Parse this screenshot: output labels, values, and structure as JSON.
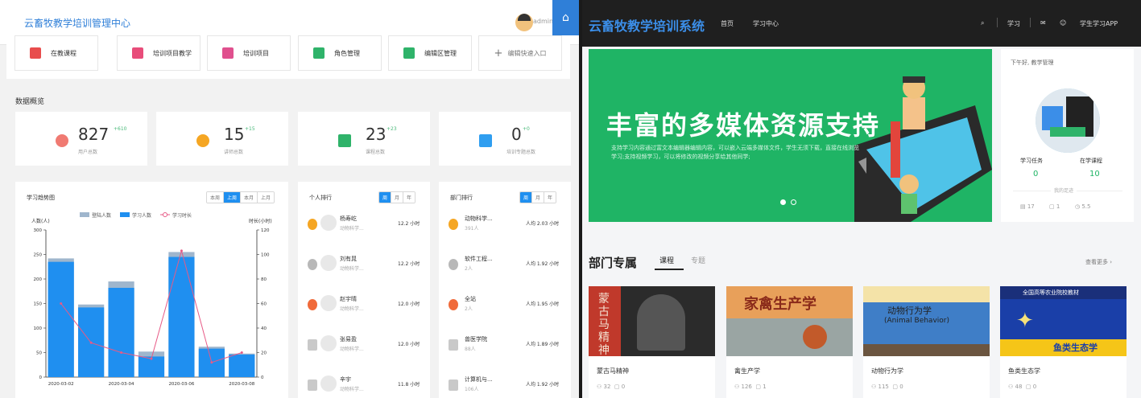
{
  "left": {
    "header": {
      "title": "云畜牧教学培训管理中心",
      "user": "admin",
      "home_icon": "home-icon"
    },
    "shortcuts": [
      {
        "label": "在教课程",
        "icon": "book-icon",
        "color": "#e84d4d"
      },
      {
        "label": "培训项目教学",
        "icon": "picture-icon",
        "color": "#e84d7a"
      },
      {
        "label": "培训项目",
        "icon": "calendar-icon",
        "color": "#e0508e"
      },
      {
        "label": "角色管理",
        "icon": "role-icon",
        "color": "#2fb36a"
      },
      {
        "label": "编辑区管理",
        "icon": "edit-icon",
        "color": "#2fb36a"
      },
      {
        "label": "编辑快速入口",
        "icon": "plus-icon",
        "color": "#777777"
      }
    ],
    "overview": {
      "title": "数据概览",
      "cards": [
        {
          "value": "827",
          "delta": "+610",
          "label": "用户总数",
          "icon": "user-icon",
          "color": "#f07a72"
        },
        {
          "value": "15",
          "delta": "+15",
          "label": "讲师总数",
          "icon": "teacher-icon",
          "color": "#f5a623"
        },
        {
          "value": "23",
          "delta": "+23",
          "label": "课程总数",
          "icon": "course-icon",
          "color": "#2fb36a"
        },
        {
          "value": "0",
          "delta": "+0",
          "label": "培训专题总数",
          "icon": "topic-icon",
          "color": "#2f9ef0"
        }
      ]
    },
    "trend": {
      "title": "学习趋势图",
      "ranges": [
        "本周",
        "上周",
        "本月",
        "上月"
      ],
      "active_range": "上周"
    },
    "person_rank": {
      "title": "个人排行",
      "ranges": [
        "周",
        "月",
        "年"
      ],
      "active_range": "周",
      "rows": [
        {
          "name": "杨寿屹",
          "sub": "动物科学...",
          "value": "12.2 小时",
          "medal": "gold"
        },
        {
          "name": "刘有晁",
          "sub": "动物科学...",
          "value": "12.2 小时",
          "medal": "silver"
        },
        {
          "name": "赵宇晴",
          "sub": "动物科学...",
          "value": "12.0 小时",
          "medal": "bronze"
        },
        {
          "name": "张易盈",
          "sub": "动物科学...",
          "value": "12.0 小时",
          "medal": "4"
        },
        {
          "name": "辛宇",
          "sub": "动物科学...",
          "value": "11.8 小时",
          "medal": "5"
        }
      ]
    },
    "dept_rank": {
      "title": "部门排行",
      "ranges": [
        "周",
        "月",
        "年"
      ],
      "active_range": "周",
      "rows": [
        {
          "name": "动物科学...",
          "sub": "391人",
          "value": "人均 2.03 小时",
          "medal": "gold"
        },
        {
          "name": "软件工程...",
          "sub": "2人",
          "value": "人均 1.92 小时",
          "medal": "silver"
        },
        {
          "name": "全站",
          "sub": "2人",
          "value": "人均 1.95 小时",
          "medal": "bronze"
        },
        {
          "name": "兽医学院",
          "sub": "88人",
          "value": "人均 1.89 小时",
          "medal": "4"
        },
        {
          "name": "计算机与...",
          "sub": "106人",
          "value": "人均 1.92 小时",
          "medal": "5"
        }
      ]
    }
  },
  "chart_data": {
    "type": "bar",
    "legend": [
      "登陆人数",
      "学习人数",
      "学习时长"
    ],
    "ylabel_left": "人数(人)",
    "ylabel_right": "时长(小时)",
    "ylim_left": [
      0,
      300
    ],
    "ylim_right": [
      0,
      120
    ],
    "ticks_left": [
      0,
      50,
      100,
      150,
      200,
      250,
      300
    ],
    "ticks_right": [
      0,
      20,
      40,
      60,
      80,
      100,
      120
    ],
    "x_tick_labels": [
      "2020-03-02",
      "2020-03-04",
      "2020-03-06",
      "2020-03-08"
    ],
    "categories": [
      "2020-03-02",
      "2020-03-03",
      "2020-03-04",
      "2020-03-05",
      "2020-03-06",
      "2020-03-07",
      "2020-03-08"
    ],
    "series": [
      {
        "name": "登陆人数",
        "type": "bar",
        "color": "#9fb6cd",
        "values": [
          242,
          148,
          195,
          52,
          255,
          62,
          48
        ]
      },
      {
        "name": "学习人数",
        "type": "bar",
        "color": "#1f8ff0",
        "values": [
          235,
          142,
          182,
          42,
          245,
          58,
          46
        ]
      },
      {
        "name": "学习时长",
        "type": "line",
        "color": "#e75a86",
        "values": [
          60,
          28,
          20,
          15,
          103,
          12,
          20
        ]
      }
    ]
  },
  "right": {
    "nav": {
      "logo": "云畜牧教学培训系统",
      "links": [
        "首页",
        "学习中心"
      ],
      "right_links": [
        "学习",
        "学生学习APP"
      ]
    },
    "banner": {
      "title": "丰富的多媒体资源支持",
      "desc": "支持学习内容通过富文本编辑器编辑内容，可以嵌入云端多媒体文件，学生无须下载，直接在线浏览学习;支持视频学习，可以将修改的视频分享给其他同学;"
    },
    "profile": {
      "greeting": "下午好, 教学管理",
      "stats": [
        {
          "label": "学习任务",
          "value": "0"
        },
        {
          "label": "在学课程",
          "value": "10"
        }
      ],
      "footprint": "我的足迹",
      "counts": [
        "17",
        "1",
        "5.5"
      ]
    },
    "dept": {
      "title": "部门专属",
      "tabs": [
        "课程",
        "专题"
      ],
      "active_tab": "课程",
      "more": "查看更多 ›",
      "courses": [
        {
          "name": "蒙古马精神",
          "views": "32",
          "comments": "0",
          "cover_text": "蒙古马精神"
        },
        {
          "name": "禽生产学",
          "views": "126",
          "comments": "1",
          "cover_text": "家禽生产学"
        },
        {
          "name": "动物行为学",
          "views": "115",
          "comments": "0",
          "cover_text": "动物行为学",
          "cover_sub": "(Animal Behavior)"
        },
        {
          "name": "鱼类生态学",
          "views": "48",
          "comments": "0",
          "cover_text": "鱼类生态学",
          "cover_sub": "全国高等农业院校教材"
        }
      ]
    }
  }
}
